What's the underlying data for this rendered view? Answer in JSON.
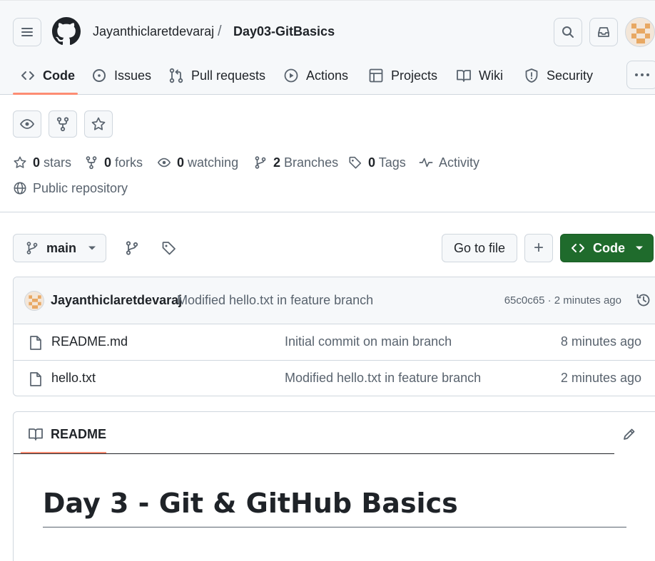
{
  "header": {
    "owner": "Jayanthiclaretdevaraj",
    "separator": "/",
    "repo": "Day03-GitBasics"
  },
  "nav": {
    "code": "Code",
    "issues": "Issues",
    "pull_requests": "Pull requests",
    "actions": "Actions",
    "projects": "Projects",
    "wiki": "Wiki",
    "security": "Security"
  },
  "stats": {
    "stars_count": "0",
    "stars_label": "stars",
    "forks_count": "0",
    "forks_label": "forks",
    "watching_count": "0",
    "watching_label": "watching",
    "branches_count": "2",
    "branches_label": "Branches",
    "tags_count": "0",
    "tags_label": "Tags",
    "activity_label": "Activity",
    "visibility": "Public repository"
  },
  "toolbar": {
    "branch": "main",
    "go_to_file": "Go to file",
    "add": "+",
    "code": "Code"
  },
  "latest_commit": {
    "author": "Jayanthiclaretdevaraj",
    "message": "Modified hello.txt in feature branch",
    "hash_time": "65c0c65 · 2 minutes ago"
  },
  "files": [
    {
      "name": "README.md",
      "message": "Initial commit on main branch",
      "time": "8 minutes ago"
    },
    {
      "name": "hello.txt",
      "message": "Modified hello.txt in feature branch",
      "time": "2 minutes ago"
    }
  ],
  "readme": {
    "tab": "README",
    "heading": "Day 3 - Git & GitHub Basics"
  },
  "colors": {
    "accent_underline": "#fd8c73",
    "code_button": "#1f6b2c",
    "muted_text": "#59636e"
  }
}
